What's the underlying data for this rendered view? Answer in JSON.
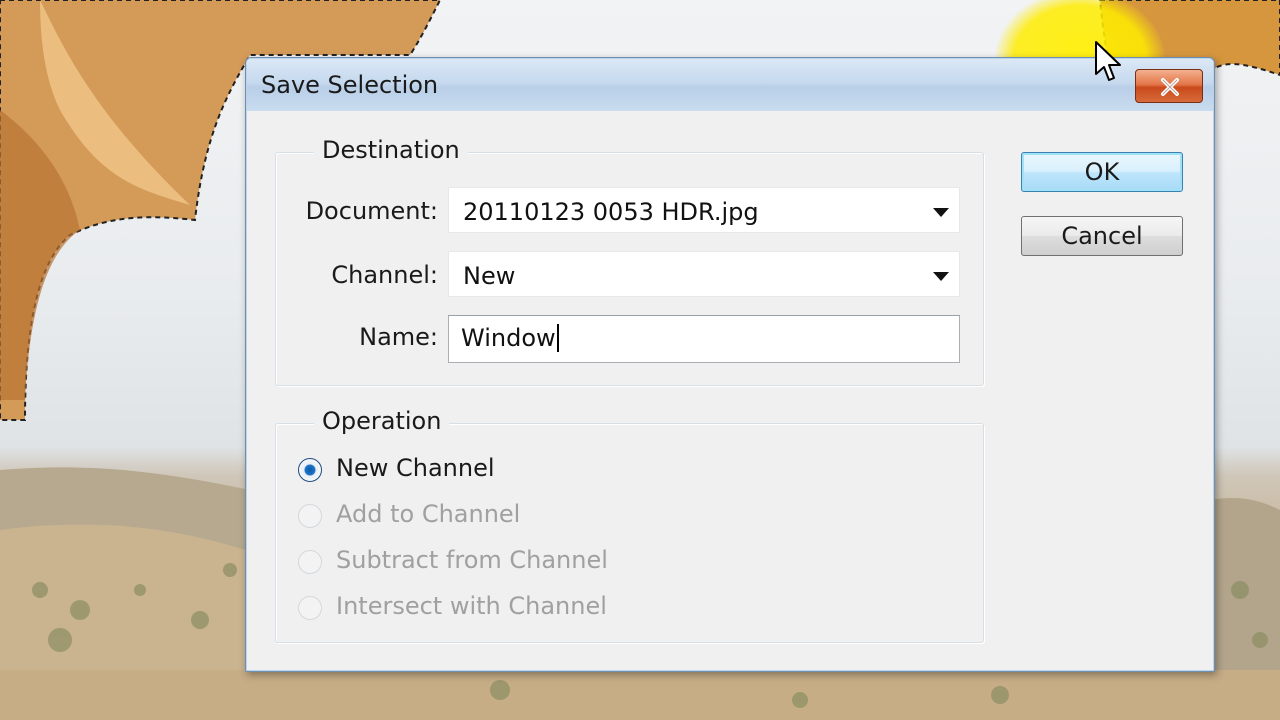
{
  "dialog": {
    "title": "Save Selection",
    "destination": {
      "legend": "Destination",
      "document_label": "Document:",
      "document_value": "20110123 0053 HDR.jpg",
      "channel_label": "Channel:",
      "channel_value": "New",
      "name_label": "Name:",
      "name_value": "Window"
    },
    "operation": {
      "legend": "Operation",
      "options": [
        {
          "label": "New Channel",
          "selected": true,
          "enabled": true
        },
        {
          "label": "Add to Channel",
          "selected": false,
          "enabled": false
        },
        {
          "label": "Subtract from Channel",
          "selected": false,
          "enabled": false
        },
        {
          "label": "Intersect with Channel",
          "selected": false,
          "enabled": false
        }
      ]
    },
    "buttons": {
      "ok": "OK",
      "cancel": "Cancel"
    }
  },
  "icons": {
    "close": "close-icon",
    "cursor": "mouse-pointer-icon"
  },
  "colors": {
    "title_bar": "#c6d9ee",
    "close_button": "#d86a3a",
    "default_button_border": "#3c7fb1",
    "cursor_highlight": "#ffec00"
  }
}
